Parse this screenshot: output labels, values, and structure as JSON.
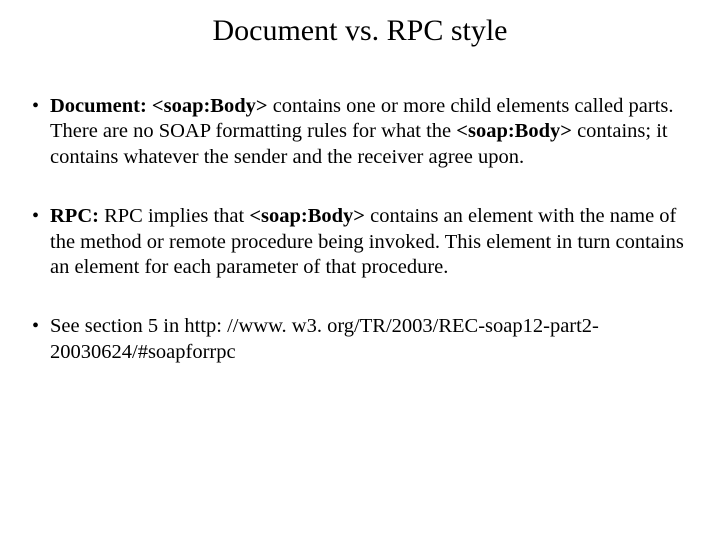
{
  "title": "Document vs. RPC style",
  "bullets": [
    {
      "lead": "Document:",
      "tag1": "<soap:Body>",
      "mid": " contains one or more child elements called parts. There are no SOAP formatting rules for what the ",
      "tag2": "<soap:Body>",
      "tail": " contains; it contains whatever the sender and the receiver agree upon."
    },
    {
      "lead": "RPC:",
      "mid1": " RPC implies that ",
      "tag1": "<soap:Body>",
      "tail": " contains an element with the name of the method or remote procedure being invoked. This element in turn contains an element for each parameter of that procedure."
    },
    {
      "text": "See section 5 in http: //www. w3. org/TR/2003/REC-soap12-part2-20030624/#soapforrpc"
    }
  ]
}
